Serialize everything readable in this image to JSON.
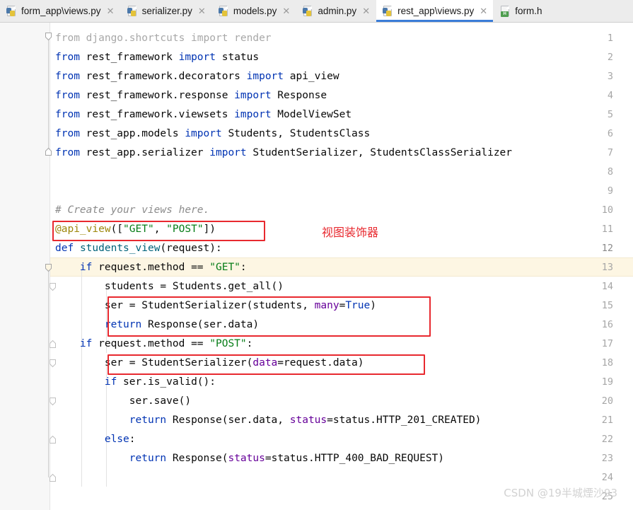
{
  "editor": {
    "app": "PyCharm",
    "active_file": "rest_app\\views.py",
    "current_line": 12,
    "first_line": 1,
    "last_line": 25,
    "colors": {
      "keyword": "#0033B3",
      "string": "#067D17",
      "comment": "#8C8C8C",
      "decorator": "#9E880D",
      "named_arg": "#660099",
      "function": "#00627A",
      "annotation_red": "#E8292F",
      "active_tab_underline": "#3B7DD8",
      "current_line_bg": "#FDF6E3",
      "gutter_bg": "#F7F7F7",
      "editor_bg": "#FFFFFF"
    }
  },
  "tabs": [
    {
      "label": "form_app\\views.py",
      "icon": "python-file-icon",
      "active": false,
      "closable": true
    },
    {
      "label": "serializer.py",
      "icon": "python-file-icon",
      "active": false,
      "closable": true
    },
    {
      "label": "models.py",
      "icon": "python-file-icon",
      "active": false,
      "closable": true
    },
    {
      "label": "admin.py",
      "icon": "python-file-icon",
      "active": false,
      "closable": true
    },
    {
      "label": "rest_app\\views.py",
      "icon": "python-file-icon",
      "active": true,
      "closable": true
    },
    {
      "label": "form.h",
      "icon": "html-file-icon",
      "active": false,
      "closable": false
    }
  ],
  "tab_close_glyph": "✕",
  "gutter": {
    "line_numbers": [
      1,
      2,
      3,
      4,
      5,
      6,
      7,
      8,
      9,
      10,
      11,
      12,
      13,
      14,
      15,
      16,
      17,
      18,
      19,
      20,
      21,
      22,
      23,
      24,
      25
    ],
    "fold_markers": [
      {
        "line": 1,
        "type": "collapse-down"
      },
      {
        "line": 7,
        "type": "collapse-up"
      },
      {
        "line": 12,
        "type": "collapse-down"
      },
      {
        "line": 13,
        "type": "collapse-down"
      },
      {
        "line": 16,
        "type": "collapse-up"
      },
      {
        "line": 17,
        "type": "collapse-down"
      },
      {
        "line": 19,
        "type": "collapse-down"
      },
      {
        "line": 21,
        "type": "collapse-up"
      },
      {
        "line": 23,
        "type": "collapse-up"
      }
    ]
  },
  "code": {
    "language": "python",
    "lines": [
      {
        "n": 1,
        "text": "from django.shortcuts import render",
        "indent": 0
      },
      {
        "n": 2,
        "text": "from rest_framework import status",
        "indent": 0
      },
      {
        "n": 3,
        "text": "from rest_framework.decorators import api_view",
        "indent": 0
      },
      {
        "n": 4,
        "text": "from rest_framework.response import Response",
        "indent": 0
      },
      {
        "n": 5,
        "text": "from rest_framework.viewsets import ModelViewSet",
        "indent": 0
      },
      {
        "n": 6,
        "text": "from rest_app.models import Students, StudentsClass",
        "indent": 0
      },
      {
        "n": 7,
        "text": "from rest_app.serializer import StudentSerializer, StudentsClassSerializer",
        "indent": 0
      },
      {
        "n": 8,
        "text": "",
        "indent": 0
      },
      {
        "n": 9,
        "text": "",
        "indent": 0
      },
      {
        "n": 10,
        "text": "# Create your views here.",
        "indent": 0
      },
      {
        "n": 11,
        "text": "@api_view([\"GET\", \"POST\"])",
        "indent": 0
      },
      {
        "n": 12,
        "text": "def students_view(request):",
        "indent": 0
      },
      {
        "n": 13,
        "text": "    if request.method == \"GET\":",
        "indent": 1
      },
      {
        "n": 14,
        "text": "        students = Students.get_all()",
        "indent": 2
      },
      {
        "n": 15,
        "text": "        ser = StudentSerializer(students, many=True)",
        "indent": 2
      },
      {
        "n": 16,
        "text": "        return Response(ser.data)",
        "indent": 2
      },
      {
        "n": 17,
        "text": "    if request.method == \"POST\":",
        "indent": 1
      },
      {
        "n": 18,
        "text": "        ser = StudentSerializer(data=request.data)",
        "indent": 2
      },
      {
        "n": 19,
        "text": "        if ser.is_valid():",
        "indent": 2
      },
      {
        "n": 20,
        "text": "            ser.save()",
        "indent": 3
      },
      {
        "n": 21,
        "text": "            return Response(ser.data, status=status.HTTP_201_CREATED)",
        "indent": 3
      },
      {
        "n": 22,
        "text": "        else:",
        "indent": 2
      },
      {
        "n": 23,
        "text": "            return Response(status=status.HTTP_400_BAD_REQUEST)",
        "indent": 3
      },
      {
        "n": 24,
        "text": "",
        "indent": 0
      },
      {
        "n": 25,
        "text": "",
        "indent": 0
      }
    ]
  },
  "annotations": {
    "boxes": [
      {
        "id": "box-decorator",
        "target_lines": "11",
        "color": "#E8292F"
      },
      {
        "id": "box-get-serializer",
        "target_lines": "15-16",
        "color": "#E8292F"
      },
      {
        "id": "box-post-serializer",
        "target_lines": "18",
        "color": "#E8292F"
      }
    ],
    "labels": [
      {
        "id": "label-view-decorator",
        "text": "视图装饰器",
        "color": "#E8292F"
      }
    ]
  },
  "watermark": {
    "text": "CSDN @19半城煙沙93"
  }
}
